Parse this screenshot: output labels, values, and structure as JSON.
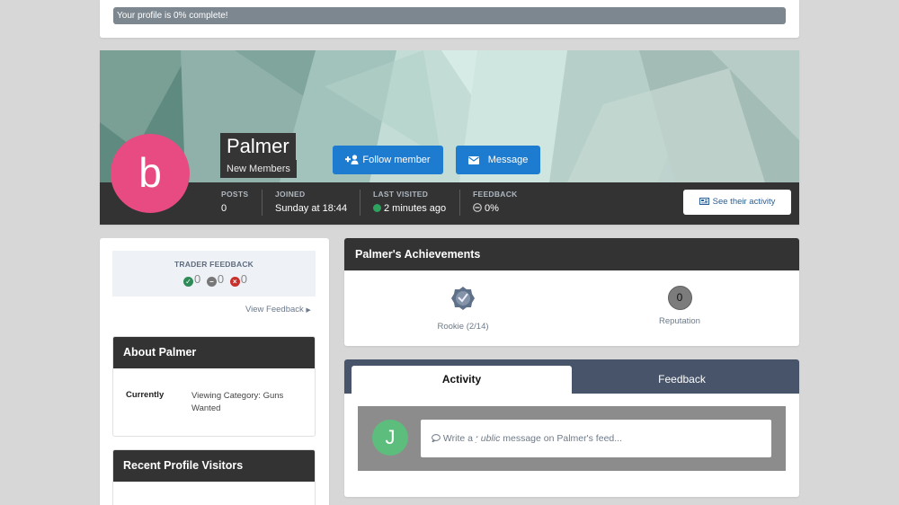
{
  "completion": {
    "text": "Your profile is 0% complete!"
  },
  "profile": {
    "avatar_letter": "b",
    "name": "Palmer",
    "group": "New Members",
    "follow_label": "Follow member",
    "message_label": "Message",
    "activity_button": "See their activity",
    "stats": {
      "posts": {
        "label": "POSTS",
        "value": "0"
      },
      "joined": {
        "label": "JOINED",
        "value": "Sunday at 18:44"
      },
      "last_visited": {
        "label": "LAST VISITED",
        "value": "2 minutes ago"
      },
      "feedback": {
        "label": "FEEDBACK",
        "value": "0%"
      }
    },
    "colors": {
      "avatar": "#e84b82",
      "online_dot": "#2ea35f",
      "button": "#1d7cd0"
    }
  },
  "sidebar": {
    "trader_feedback": {
      "title": "TRADER FEEDBACK",
      "positive": "0",
      "neutral": "0",
      "negative": "0"
    },
    "view_feedback": "View Feedback",
    "about": {
      "title": "About Palmer",
      "key": "Currently",
      "value": "Viewing Category: Guns Wanted"
    },
    "visitors": {
      "title": "Recent Profile Visitors"
    }
  },
  "achievements": {
    "title": "Palmer's Achievements",
    "rank_label": "Rookie (2/14)",
    "reputation_value": "0",
    "reputation_label": "Reputation"
  },
  "activity": {
    "tabs": [
      "Activity",
      "Feedback"
    ],
    "composer_avatar": "J",
    "composer_prefix": "Write a ",
    "composer_emphasis": "public",
    "composer_suffix": " message on Palmer's feed..."
  }
}
